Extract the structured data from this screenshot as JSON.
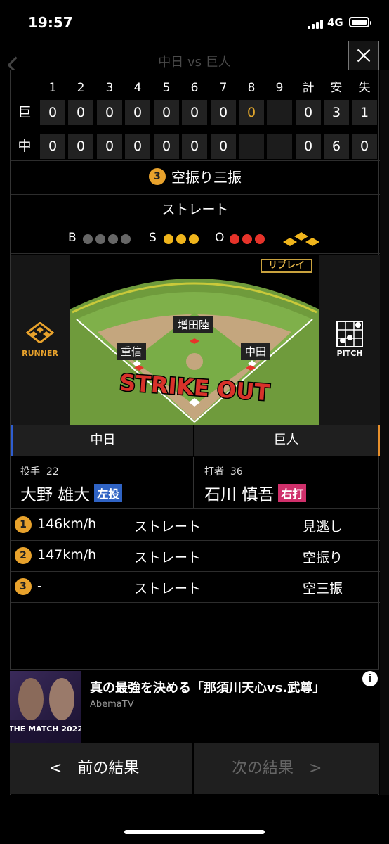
{
  "status": {
    "time": "19:57",
    "network": "4G"
  },
  "background": {
    "title": "中日 vs 巨人"
  },
  "scoreboard": {
    "headers": [
      "1",
      "2",
      "3",
      "4",
      "5",
      "6",
      "7",
      "8",
      "9",
      "計",
      "安",
      "失"
    ],
    "rows": [
      {
        "team": "巨",
        "cells": [
          "0",
          "0",
          "0",
          "0",
          "0",
          "0",
          "0",
          "0",
          "",
          "0",
          "3",
          "1"
        ]
      },
      {
        "team": "中",
        "cells": [
          "0",
          "0",
          "0",
          "0",
          "0",
          "0",
          "0",
          "",
          "",
          "0",
          "6",
          "0"
        ]
      }
    ]
  },
  "result": {
    "number": "3",
    "text": "空振り三振"
  },
  "pitch_type": "ストレート",
  "count": {
    "b_label": "B",
    "s_label": "S",
    "o_label": "O",
    "balls": 0,
    "strikes": 3,
    "outs": 3
  },
  "field": {
    "replay": "リプレイ",
    "runner_label": "RUNNER",
    "pitch_label": "PITCH",
    "positions": {
      "center": "増田陸",
      "short": "重信",
      "first": "中田"
    },
    "strike_out": "STRIKE OUT"
  },
  "teams": {
    "left": "中日",
    "right": "巨人"
  },
  "pitcher": {
    "role": "投手",
    "number": "22",
    "name": "大野 雄大",
    "hand": "左投"
  },
  "batter": {
    "role": "打者",
    "number": "36",
    "name": "石川 慎吾",
    "hand": "右打"
  },
  "pitches": [
    {
      "num": "1",
      "speed": "146km/h",
      "type": "ストレート",
      "result": "見逃し"
    },
    {
      "num": "2",
      "speed": "147km/h",
      "type": "ストレート",
      "result": "空振り"
    },
    {
      "num": "3",
      "speed": "-",
      "type": "ストレート",
      "result": "空三振"
    }
  ],
  "ad": {
    "title": "真の最強を決める「那須川天心vs.武尊」",
    "source": "AbemaTV",
    "thumb_text": "THE MATCH 2022"
  },
  "nav": {
    "prev": "<　前の結果",
    "next": "次の結果　>"
  },
  "colors": {
    "accent": "#e8a22c",
    "ball": "#666666",
    "strike": "#f0b51c",
    "out": "#e6332a"
  }
}
